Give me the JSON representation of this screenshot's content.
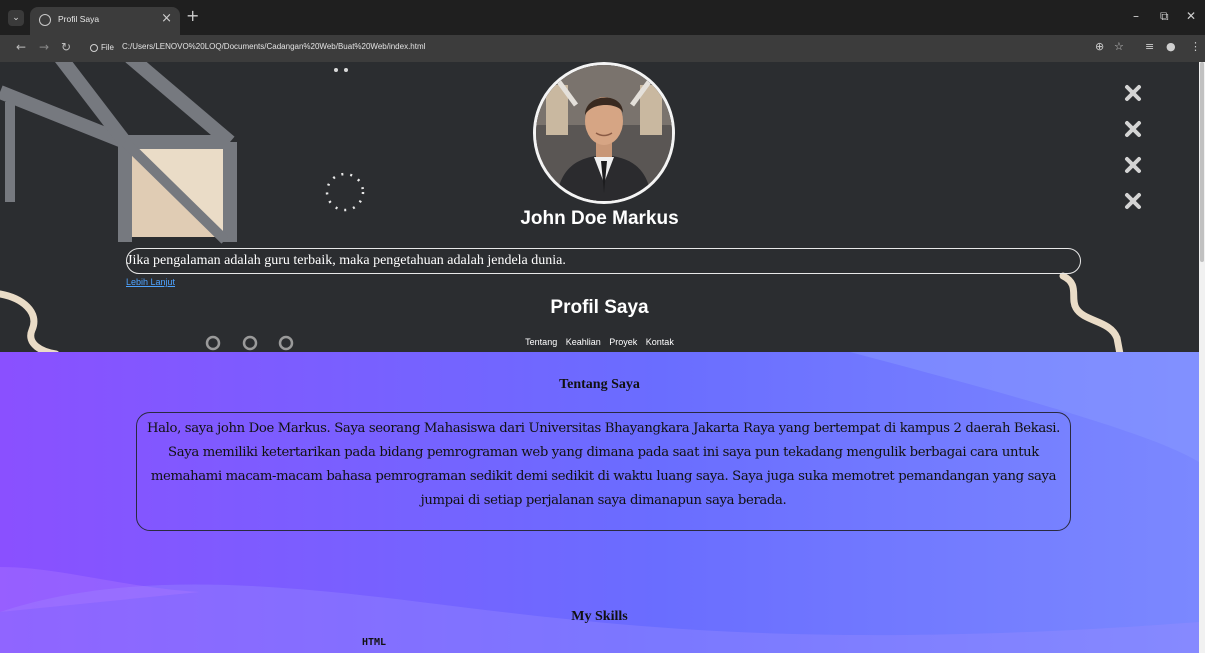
{
  "browser": {
    "tab_title": "Profil Saya",
    "tab_close": "×",
    "new_tab": "+",
    "tab_menu": "⌄",
    "window_minimize": "–",
    "window_restore": "⧉",
    "window_close": "✕",
    "nav_back": "←",
    "nav_forward": "→",
    "nav_reload": "↻",
    "chip_label": "File",
    "url": "C:/Users/LENOVO%20LOQ/Documents/Cadangan%20Web/Buat%20Web/index.html",
    "zoom_icon": "⊕",
    "bookmark_icon": "☆",
    "menu_icon": "⋮"
  },
  "header": {
    "name": "John Doe Markus",
    "quote": "Jika pengalaman adalah guru terbaik, maka pengetahuan adalah jendela dunia.",
    "more_link": "Lebih Lanjut",
    "subtitle": "Profil Saya",
    "nav": [
      "Tentang",
      "Keahlian",
      "Proyek",
      "Kontak"
    ]
  },
  "about": {
    "title": "Tentang Saya",
    "text": "Halo, saya john Doe Markus. Saya seorang Mahasiswa dari Universitas Bhayangkara Jakarta Raya yang bertempat di kampus 2 daerah Bekasi. Saya memiliki ketertarikan pada bidang pemrograman web yang dimana pada saat ini saya pun tekadang mengulik berbagai cara untuk memahami macam-macam bahasa pemrograman sedikit demi sedikit di waktu luang saya. Saya juga suka memotret pemandangan yang saya jumpai di setiap perjalanan saya dimanapun saya berada."
  },
  "skills": {
    "title": "My Skills",
    "first_skill": "HTML"
  },
  "colors": {
    "header_bg": "#2b2d30",
    "content_gradient_start": "#8a50ff",
    "content_gradient_end": "#7b88ff",
    "link": "#4ea3ff"
  }
}
